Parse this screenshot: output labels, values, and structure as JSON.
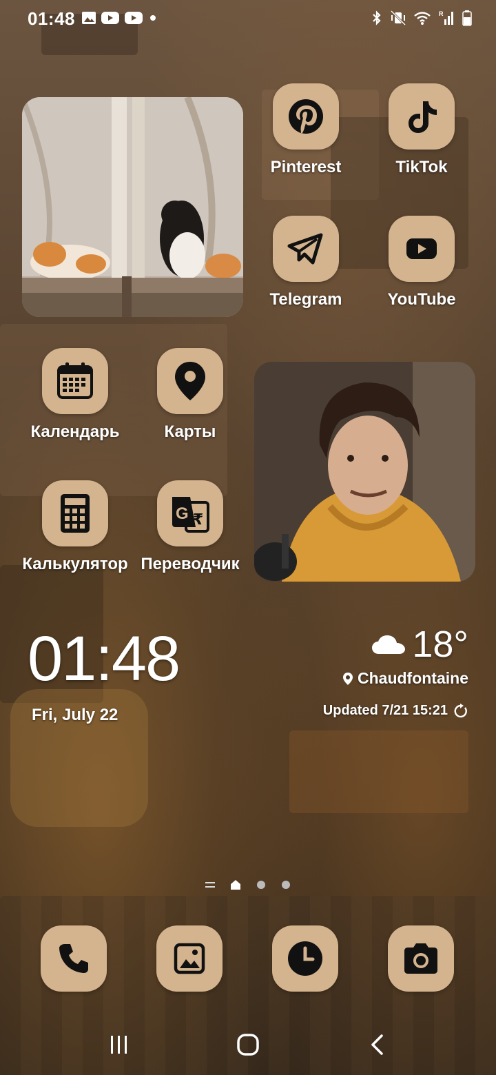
{
  "status_bar": {
    "time": "01:48",
    "notification_icons": [
      "gallery-icon",
      "youtube-icon",
      "youtube-icon",
      "dot-icon"
    ],
    "system_icons": [
      "bluetooth-icon",
      "mute-vibrate-icon",
      "wifi-icon",
      "signal-roaming-icon",
      "battery-icon"
    ]
  },
  "apps": {
    "pinterest": "Pinterest",
    "tiktok": "TikTok",
    "telegram": "Telegram",
    "youtube": "YouTube",
    "calendar": "Календарь",
    "maps": "Карты",
    "calculator": "Калькулятор",
    "translator": "Переводчик"
  },
  "clock_widget": {
    "time": "01:48",
    "date": "Fri, July 22"
  },
  "weather_widget": {
    "temperature": "18°",
    "icon": "cloud-icon",
    "location": "Chaudfontaine",
    "updated": "Updated 7/21 15:21"
  },
  "page_indicator": {
    "pages": [
      "menu-lines",
      "home",
      "page-2",
      "page-3"
    ],
    "active": "home"
  },
  "dock": {
    "apps": [
      "phone-icon",
      "gallery-icon",
      "clock-icon",
      "camera-icon"
    ]
  },
  "nav_bar": {
    "buttons": [
      "recent-apps-icon",
      "home-icon",
      "back-icon"
    ]
  },
  "colors": {
    "icon_bg": "#d4b48f",
    "icon_fg": "#111111",
    "text": "#ffffff"
  },
  "widgets": {
    "photo_1": "photo-cats-window",
    "photo_2": "photo-person-yellow-hoodie"
  }
}
